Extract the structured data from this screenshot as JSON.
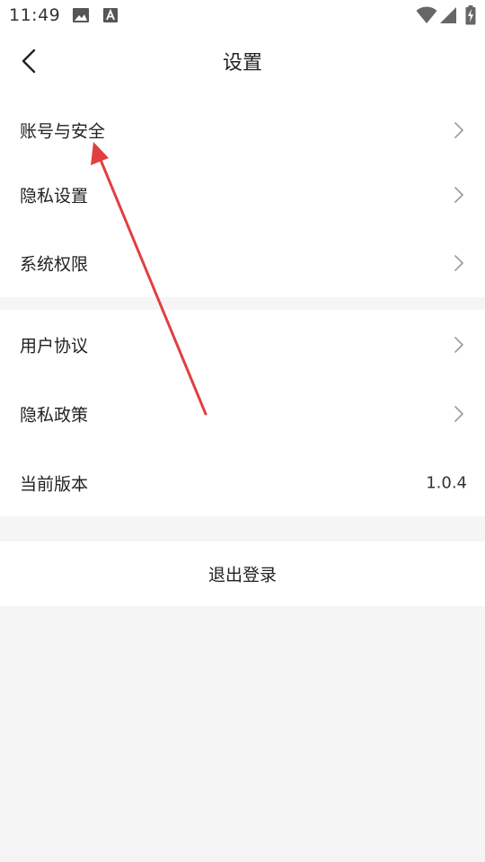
{
  "status_bar": {
    "time": "11:49",
    "icons": [
      "image-icon",
      "font-icon",
      "wifi-icon",
      "signal-icon",
      "battery-charging-icon"
    ]
  },
  "header": {
    "title": "设置",
    "back_icon": "chevron-left-icon"
  },
  "group1": {
    "items": [
      {
        "label": "账号与安全",
        "icon": "chevron-right-icon"
      },
      {
        "label": "隐私设置",
        "icon": "chevron-right-icon"
      },
      {
        "label": "系统权限",
        "icon": "chevron-right-icon"
      }
    ]
  },
  "group2": {
    "items": [
      {
        "label": "用户协议",
        "icon": "chevron-right-icon"
      },
      {
        "label": "隐私政策",
        "icon": "chevron-right-icon"
      },
      {
        "label": "当前版本",
        "value": "1.0.4"
      }
    ]
  },
  "logout": {
    "label": "退出登录"
  },
  "annotation": {
    "arrow_color": "#e04040",
    "points_to": "账号与安全"
  },
  "colors": {
    "background": "#f5f5f5",
    "surface": "#ffffff",
    "text": "#222222",
    "chevron": "#999999"
  }
}
